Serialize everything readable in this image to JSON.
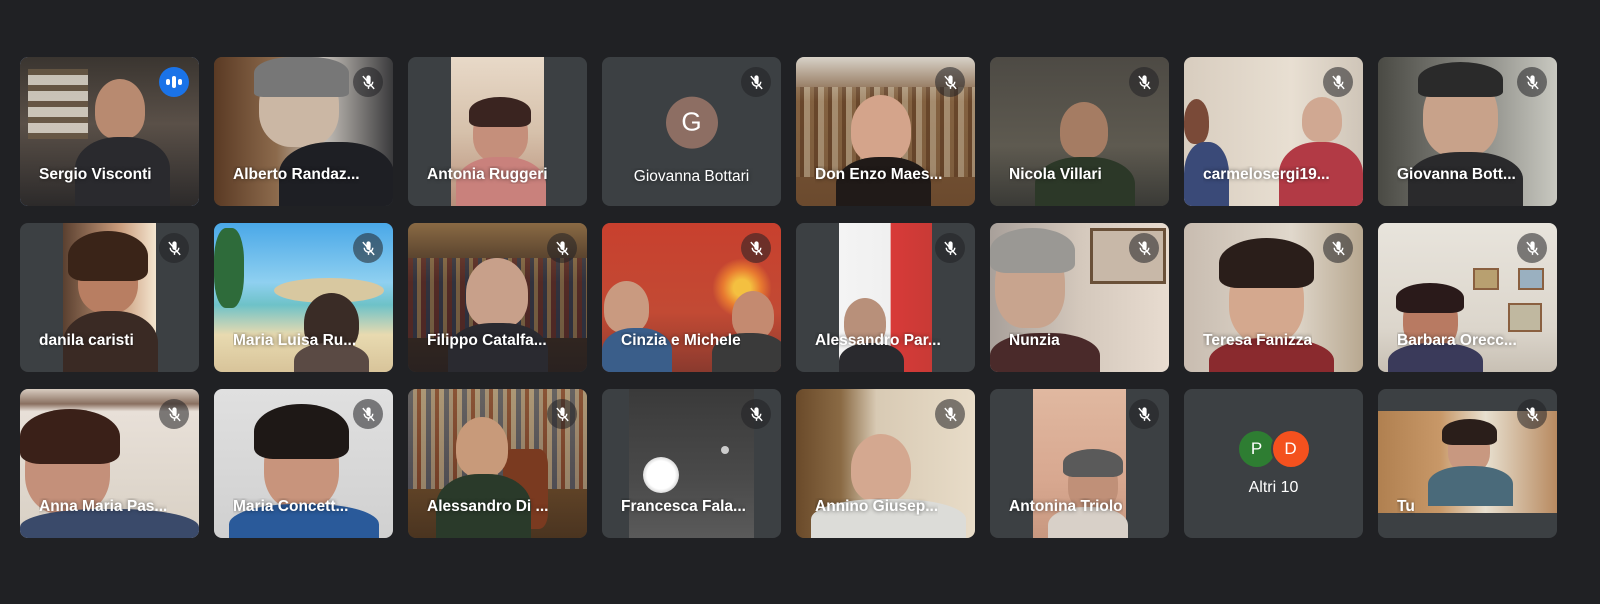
{
  "participants": [
    {
      "name": "Sergio Visconti",
      "speaking": true
    },
    {
      "name": "Alberto Randaz..."
    },
    {
      "name": "Antonia Ruggeri"
    },
    {
      "name": "Giovanna Bottari",
      "avatar_letter": "G"
    },
    {
      "name": "Don Enzo Maes..."
    },
    {
      "name": "Nicola Villari"
    },
    {
      "name": "carmelosergi19..."
    },
    {
      "name": "Giovanna Bott..."
    },
    {
      "name": "danila caristi"
    },
    {
      "name": "Maria Luisa Ru..."
    },
    {
      "name": "Filippo Catalfa..."
    },
    {
      "name": "Cinzia e Michele"
    },
    {
      "name": "Alessandro Par..."
    },
    {
      "name": "Nunzia"
    },
    {
      "name": "Teresa Fanizza"
    },
    {
      "name": "Barbara Orecc..."
    },
    {
      "name": "Anna Maria Pas..."
    },
    {
      "name": "Maria Concett..."
    },
    {
      "name": "Alessandro Di ..."
    },
    {
      "name": "Francesca Fala..."
    },
    {
      "name": "Annino Giusep..."
    },
    {
      "name": "Antonina Triolo"
    },
    {
      "name": "Tu"
    }
  ],
  "others": {
    "label": "Altri 10",
    "avatars": [
      {
        "letter": "P",
        "color": "#2e7d32"
      },
      {
        "letter": "D",
        "color": "#f4511e"
      }
    ]
  },
  "colors": {
    "background": "#202124",
    "tile": "#3c4043",
    "active_speaker_border": "#8ab4f8",
    "speaking_badge": "#1a73e8",
    "avatar_g": "#8d6e63"
  },
  "icons": {
    "muted": "mic-off-icon",
    "speaking": "audio-level-icon"
  }
}
